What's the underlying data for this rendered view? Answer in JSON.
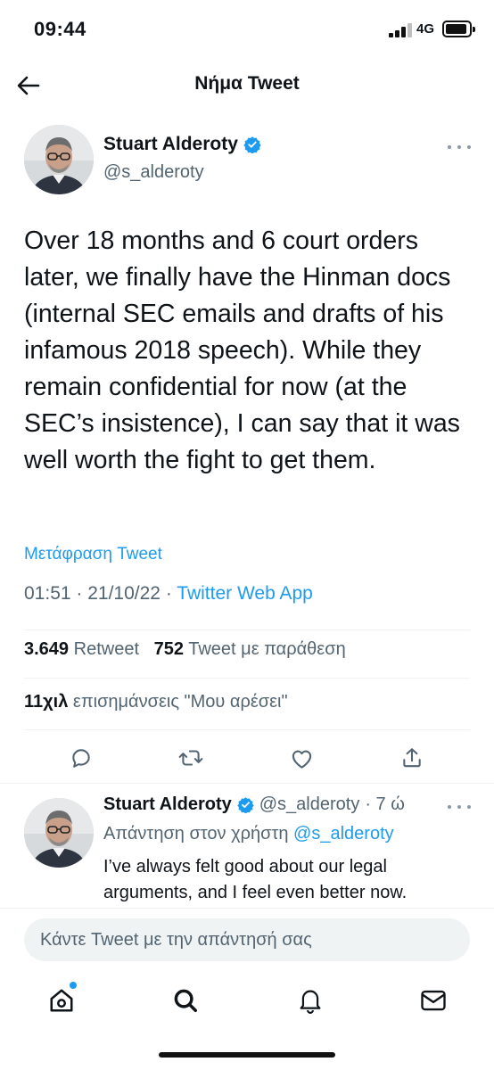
{
  "status_bar": {
    "time": "09:44",
    "network": "4G",
    "signal_bars_filled": 3,
    "signal_bars_total": 4,
    "battery_level": 0.8,
    "icons": [
      "signal-icon",
      "battery-icon"
    ]
  },
  "header": {
    "title": "Νήμα Tweet",
    "back_icon": "arrow-left-icon"
  },
  "tweet": {
    "author_name": "Stuart Alderoty",
    "author_handle": "@s_alderoty",
    "verified_icon": "verified-badge-icon",
    "text": "Over 18 months and 6 court orders later, we finally have the Hinman docs (internal SEC emails and drafts of his infamous 2018 speech). While they remain confidential for now (at the SEC’s insistence), I can say that it was well worth the fight to get them.",
    "translate_label": "Μετάφραση Tweet",
    "time": "01:51",
    "date": "21/10/22",
    "separator": " · ",
    "source": "Twitter Web App",
    "retweet_count": "3.649",
    "retweet_label": "Retweet",
    "quote_count": "752",
    "quote_label": "Tweet με παράθεση",
    "likes_count": "11χιλ",
    "likes_label": "επισημάνσεις \"Μου αρέσει\"",
    "action_icons": [
      "reply-icon",
      "retweet-icon",
      "like-icon",
      "share-icon"
    ]
  },
  "reply": {
    "author_name": "Stuart Alderoty",
    "author_handle": "@s_alderoty",
    "time_ago": "· 7 ώ",
    "reply_to_label": "Απάντηση στον χρήστη",
    "reply_to_handle": "@s_alderoty",
    "text": "I’ve always felt good about our legal arguments, and I feel even better now."
  },
  "compose": {
    "placeholder": "Κάντε Tweet με την απάντησή σας"
  },
  "bottom_nav": {
    "items": [
      "home-icon",
      "search-icon",
      "notifications-icon",
      "messages-icon"
    ]
  },
  "colors": {
    "accent": "#1d9bf0",
    "text": "#0f1419",
    "secondary": "#536471",
    "divider": "#eff3f4"
  }
}
